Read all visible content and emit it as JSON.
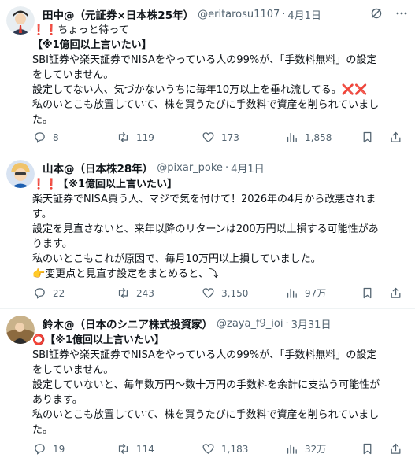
{
  "tweets": [
    {
      "name": "田中@（元証券×日本株25年）",
      "handle": "@eritarosu1107",
      "date": "4月1日",
      "lines": [
        "❗❗ちょっと待って",
        "【※1億回以上言いたい】",
        "SBI証券や楽天証券でNISAをやっている人の99%が、「手数料無料」の設定",
        "をしていません。",
        "設定してない人、気づかないうちに毎年10万以上を垂れ流してる。❌❌",
        "私のいとこも放置していて、株を買うたびに手数料で資産を削られていまし",
        "た。"
      ],
      "replies": "8",
      "reposts": "119",
      "likes": "173",
      "views": "1,858"
    },
    {
      "name": "山本@（日本株28年）",
      "handle": "@pixar_poke",
      "date": "4月1日",
      "lines": [
        "❗❗【※1億回以上言いたい】",
        "楽天証券でNISA買う人、マジで気を付けて！2026年の4月から改悪されま",
        "す。",
        "設定を見直さないと、来年以降のリターンは200万円以上損する可能性があ",
        "ります。",
        "私のいとこもこれが原因で、毎月10万円以上損していました。",
        "👉変更点と見直す設定をまとめると、⤵"
      ],
      "replies": "22",
      "reposts": "243",
      "likes": "3,150",
      "views": "97万"
    },
    {
      "name": "鈴木@（日本のシニア株式投資家）",
      "handle": "@zaya_f9_ioi",
      "date": "3月31日",
      "lines": [
        "⭕【※1億回以上言いたい】",
        "SBI証券や楽天証券でNISAをやっている人の99%が、「手数料無料」の設定",
        "をしていません。",
        "設定していないと、毎年数万円〜数十万円の手数料を余計に支払う可能性が",
        "あります。",
        "私のいとこも放置していて、株を買うたびに手数料で資産を削られていまし",
        "た。"
      ],
      "replies": "19",
      "reposts": "114",
      "likes": "1,183",
      "views": "32万"
    }
  ],
  "icons": {
    "grok": "grok-icon",
    "more": "more-icon",
    "reply": "reply-icon",
    "repost": "repost-icon",
    "like": "like-icon",
    "views": "views-icon",
    "bookmark": "bookmark-icon",
    "share": "share-icon"
  },
  "colors": {
    "text": "#0f1419",
    "muted": "#536471",
    "divider": "#eff3f4",
    "red": "#d81e2a"
  }
}
